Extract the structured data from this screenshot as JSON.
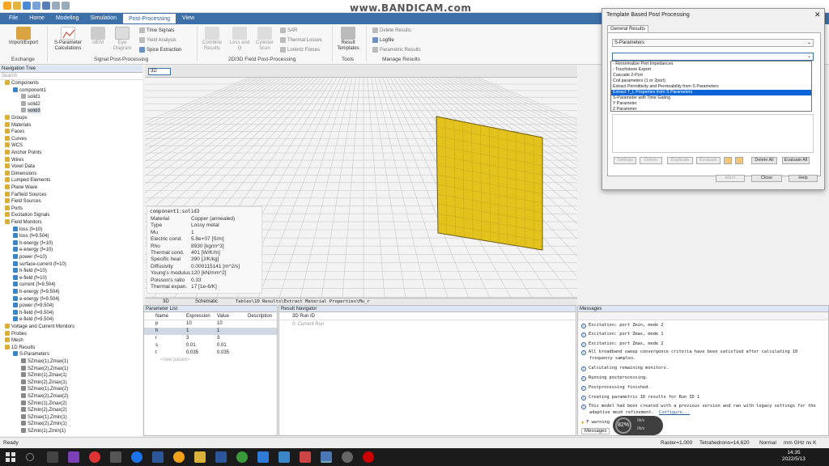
{
  "watermark": "www.BANDICAM.com",
  "menu": [
    "File",
    "Home",
    "Modeling",
    "Simulation",
    "Post-Processing",
    "View"
  ],
  "ribbon": {
    "import_export": "Import/Export",
    "exchange": "Exchange",
    "sparam_calc": "S-Parameter Calculations",
    "idem": "IdEM",
    "eye_diagram": "Eye Diagram",
    "time_signals": "Time Signals",
    "yield_analysis": "Yield Analysis",
    "spice_extraction": "Spice Extraction",
    "signal_pp": "Signal Post-Processing",
    "combine_results": "Combine Results",
    "loss_q": "Loss and Q",
    "cylinder_scan": "Cylinder Scan",
    "sar": "SAR",
    "thermal_losses": "Thermal Losses",
    "lorentz_forces": "Lorentz Forces",
    "field_pp": "2D/3D Field Post-Processing",
    "result_templates": "Result Templates",
    "tools": "Tools",
    "delete_results": "Delete Results",
    "logfile": "Logfile",
    "param_results": "Parametric Results",
    "manage_results": "Manage Results"
  },
  "tree": {
    "header": "Navigation Tree",
    "search": "Search",
    "items": [
      "Components",
      "component1",
      "solid1",
      "solid2",
      "solid3",
      "Groups",
      "Materials",
      "Faces",
      "Curves",
      "WCS",
      "Anchor Points",
      "Wires",
      "Voxel Data",
      "Dimensions",
      "Lumped Elements",
      "Plane Wave",
      "Farfield Sources",
      "Field Sources",
      "Ports",
      "Excitation Signals",
      "Field Monitors",
      "loss (f=10)",
      "loss (f=9.504)",
      "h-energy (f=10)",
      "e-energy (f=10)",
      "power (f=10)",
      "surface-current (f=10)",
      "h-field (f=10)",
      "e-field (f=10)",
      "current (f=9.504)",
      "h-energy (f=9.504)",
      "e-energy (f=9.504)",
      "power (f=9.504)",
      "h-field (f=9.504)",
      "e-field (f=9.504)",
      "Voltage and Current Monitors",
      "Probes",
      "Mesh",
      "1D Results",
      "S-Parameters",
      "SZmax(1),Zmax(1)",
      "SZmax(2),Zmax(1)",
      "SZmin(1),Zmax(1)",
      "SZmin(2),Zmax(1)",
      "SZmax(1),Zmax(2)",
      "SZmax(2),Zmax(2)",
      "SZmin(1),Zmax(2)",
      "SZmin(2),Zmax(2)",
      "SZmax(1),Zmin(1)",
      "SZmax(2),Zmin(1)",
      "SZmin(1),Zmin(1)"
    ]
  },
  "viewport": {
    "tab_label": "3D",
    "bottom_tabs": [
      "3D",
      "Schematic",
      "Tables\\1D Results\\Extract Material Properties\\Mu_r"
    ]
  },
  "props": {
    "title": "component1:solid3",
    "rows": [
      [
        "Material",
        "Copper (annealed)"
      ],
      [
        "Type",
        "Lossy metal"
      ],
      [
        "Mu",
        "1"
      ],
      [
        "Electric cond.",
        "5.8e+07 [S/m]"
      ],
      [
        "Rho",
        "8930 [kg/m^3]"
      ],
      [
        "Thermal cond.",
        "401 [W/K/m]"
      ],
      [
        "Specific heat",
        "390 [J/K/kg]"
      ],
      [
        "Diffusivity",
        "0.000115141 [m^2/s]"
      ],
      [
        "Young's modulus",
        "120 [kN/mm^2]"
      ],
      [
        "Poisson's ratio",
        "0.33"
      ],
      [
        "Thermal expan.",
        "17 [1e-6/K]"
      ]
    ]
  },
  "param": {
    "title": "Parameter List",
    "headers": [
      "Name",
      "Expression",
      "Value",
      "Description"
    ],
    "rows": [
      [
        "p",
        "10",
        "10"
      ],
      [
        "h",
        "1",
        "1"
      ],
      [
        "r",
        "3",
        "3"
      ],
      [
        "s",
        "0.01",
        "0.01"
      ],
      [
        "t",
        "0.035",
        "0.035"
      ]
    ],
    "new": "<new param>"
  },
  "result_nav": {
    "title": "Result Navigator",
    "col": "3D Run ID",
    "row": "0: Current Run"
  },
  "messages": {
    "title": "Messages",
    "lines": [
      "Excitation: port Zmin, mode 2",
      "Excitation: port Zmax, mode 1",
      "Excitation: port Zmax, mode 2",
      "All broadband sweep convergence criteria have been satisfied after calculating 10",
      "frequency samples.",
      "Calculating remaining monitors.",
      "Running postprocessing.",
      "Postprocessing finished.",
      "Creating parametric 1D results for Run ID 1",
      "This model had been created with a previous version and ran with legacy settings for the",
      "adaptive mesh refinement.",
      "Configure...",
      "F warning"
    ],
    "tab": "Messages"
  },
  "status": {
    "left": "Ready",
    "raster": "Raster=1.000",
    "tetra": "Tetrahedrons=14,620",
    "mode": "Normal",
    "units": "mm GHz ns K"
  },
  "dialog": {
    "title": "Template Based Post Processing",
    "tab": "General Results",
    "combo1": "S-Parameters",
    "options": [
      "- Renormalize Port Impedances",
      "- Touchstone Export",
      "Cascade 2-Port",
      "Coil parameters (1 or 2port)",
      "Extract Permittivity and Permeability from S Parameters",
      "Extract T_L Properties from S Parameters",
      "S-Parameter with Time Gating",
      "Y Parameter",
      "Z Parameter"
    ],
    "selected_index": 5,
    "buttons": [
      "Settings",
      "Delete",
      "Duplicate",
      "Evaluate",
      "Delete All",
      "Evaluate All"
    ],
    "bottom": [
      "Abort",
      "Close",
      "Help"
    ]
  },
  "bubble": {
    "value": "82",
    "unit": "%",
    "a": "0k/s",
    "b": "0k/s"
  },
  "taskbar": {
    "time": "14:35",
    "date": "2022/5/13"
  }
}
